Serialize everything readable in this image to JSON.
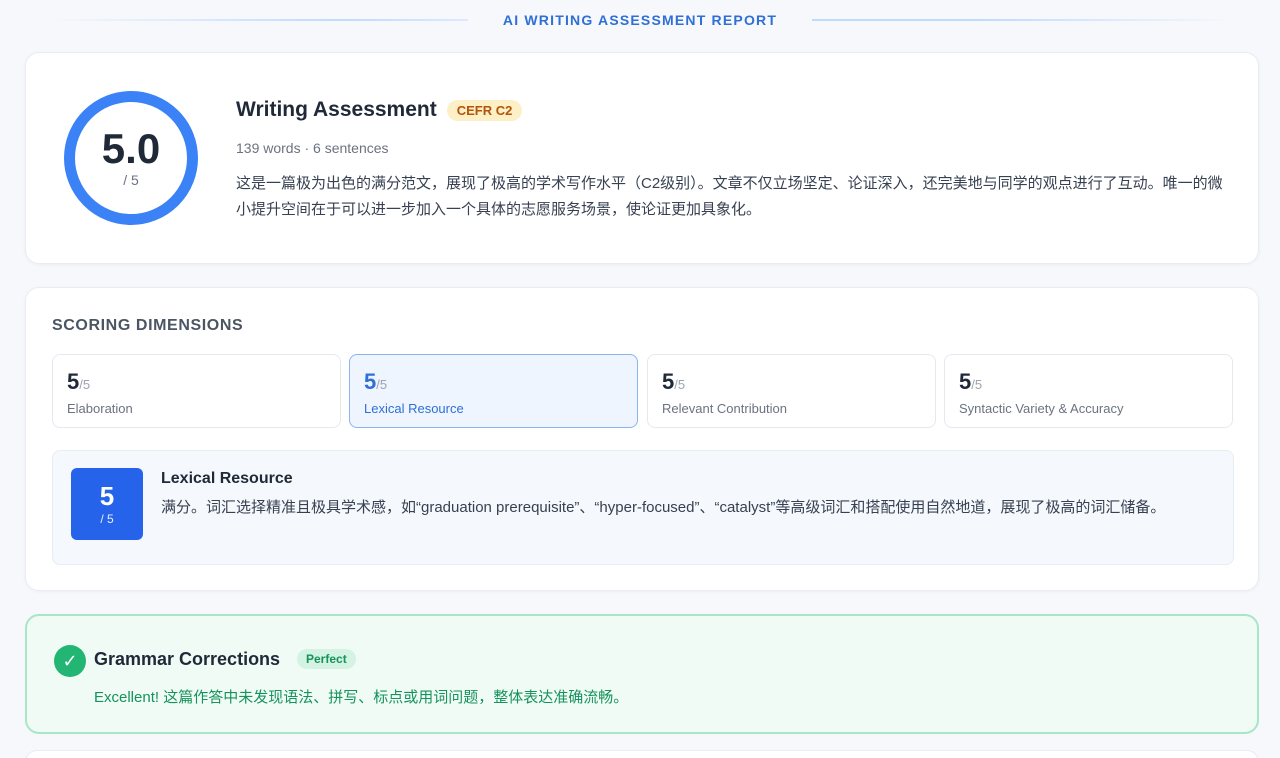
{
  "banner": {
    "title": "AI WRITING ASSESSMENT REPORT"
  },
  "summary": {
    "score": "5.0",
    "out_of": "/ 5",
    "title": "Writing Assessment",
    "cefr_badge": "CEFR C2",
    "meta": "139 words · 6 sentences",
    "description": "这是一篇极为出色的满分范文，展现了极高的学术写作水平（C2级别）。文章不仅立场坚定、论证深入，还完美地与同学的观点进行了互动。唯一的微小提升空间在于可以进一步加入一个具体的志愿服务场景，使论证更加具象化。"
  },
  "dimensions": {
    "section_title": "SCORING DIMENSIONS",
    "items": [
      {
        "score": "5",
        "max": "/5",
        "label": "Elaboration",
        "active": false
      },
      {
        "score": "5",
        "max": "/5",
        "label": "Lexical Resource",
        "active": true
      },
      {
        "score": "5",
        "max": "/5",
        "label": "Relevant Contribution",
        "active": false
      },
      {
        "score": "5",
        "max": "/5",
        "label": "Syntactic Variety & Accuracy",
        "active": false
      }
    ],
    "detail": {
      "score": "5",
      "max": "/ 5",
      "title": "Lexical Resource",
      "text": "满分。词汇选择精准且极具学术感，如“graduation prerequisite”、“hyper-focused”、“catalyst”等高级词汇和搭配使用自然地道，展现了极高的词汇储备。"
    }
  },
  "grammar": {
    "icon": "check-circle-icon",
    "title": "Grammar Corrections",
    "badge": "Perfect",
    "text": "Excellent! 这篇作答中未发现语法、拼写、标点或用词问题，整体表达准确流畅。"
  },
  "colors": {
    "accent": "#3b82f6",
    "accent_dark": "#2563eb",
    "success": "#22b573",
    "cefr_bg": "#fdf0c7",
    "cefr_text": "#b45309"
  }
}
